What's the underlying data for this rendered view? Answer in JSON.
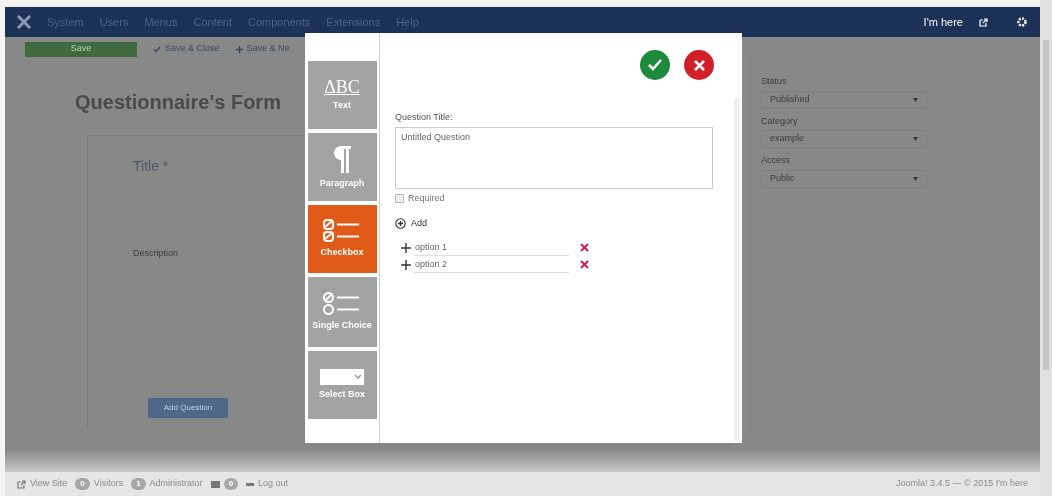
{
  "nav": {
    "menu": [
      "System",
      "Users",
      "Menus",
      "Content",
      "Components",
      "Extensions",
      "Help"
    ],
    "user": "I'm here"
  },
  "toolbar": [
    {
      "label": "Save",
      "kind": "primary"
    },
    {
      "label": "Save & Close",
      "kind": "check"
    },
    {
      "label": "Save & Ne",
      "kind": "plus"
    }
  ],
  "page_title": "Questionnaire's Form",
  "form": {
    "title_label": "Title *",
    "description_label": "Description",
    "add_button": "Add Question"
  },
  "sidebar_fields": [
    {
      "label": "Status",
      "value": "Published"
    },
    {
      "label": "Category",
      "value": "example"
    },
    {
      "label": "Access",
      "value": "Public"
    }
  ],
  "modal": {
    "tools": [
      {
        "label": "Text",
        "kind": "text",
        "icon_text": "ΔBC",
        "selected": false
      },
      {
        "label": "Paragraph",
        "kind": "paragraph",
        "selected": false
      },
      {
        "label": "Checkbox",
        "kind": "checkbox",
        "selected": true
      },
      {
        "label": "Single Choice",
        "kind": "radio",
        "selected": false
      },
      {
        "label": "Select Box",
        "kind": "select",
        "selected": false
      }
    ],
    "question_title_label": "Question Title:",
    "question_title": "Untitled Question",
    "required": {
      "label": "Required",
      "checked": false
    },
    "add": "Add",
    "options": [
      "option 1",
      "option 2"
    ]
  },
  "status_bar": {
    "items": [
      {
        "label": "View Site",
        "kind": "link"
      },
      {
        "label": "Visitors",
        "kind": "badge",
        "count": "0"
      },
      {
        "label": "Administrator",
        "kind": "badge",
        "count": "1"
      },
      {
        "kind": "mail",
        "count": "0"
      },
      {
        "label": "Log out",
        "kind": "logout"
      }
    ],
    "version": "Joomla! 3.4.5 — © 2015 I'm here"
  }
}
